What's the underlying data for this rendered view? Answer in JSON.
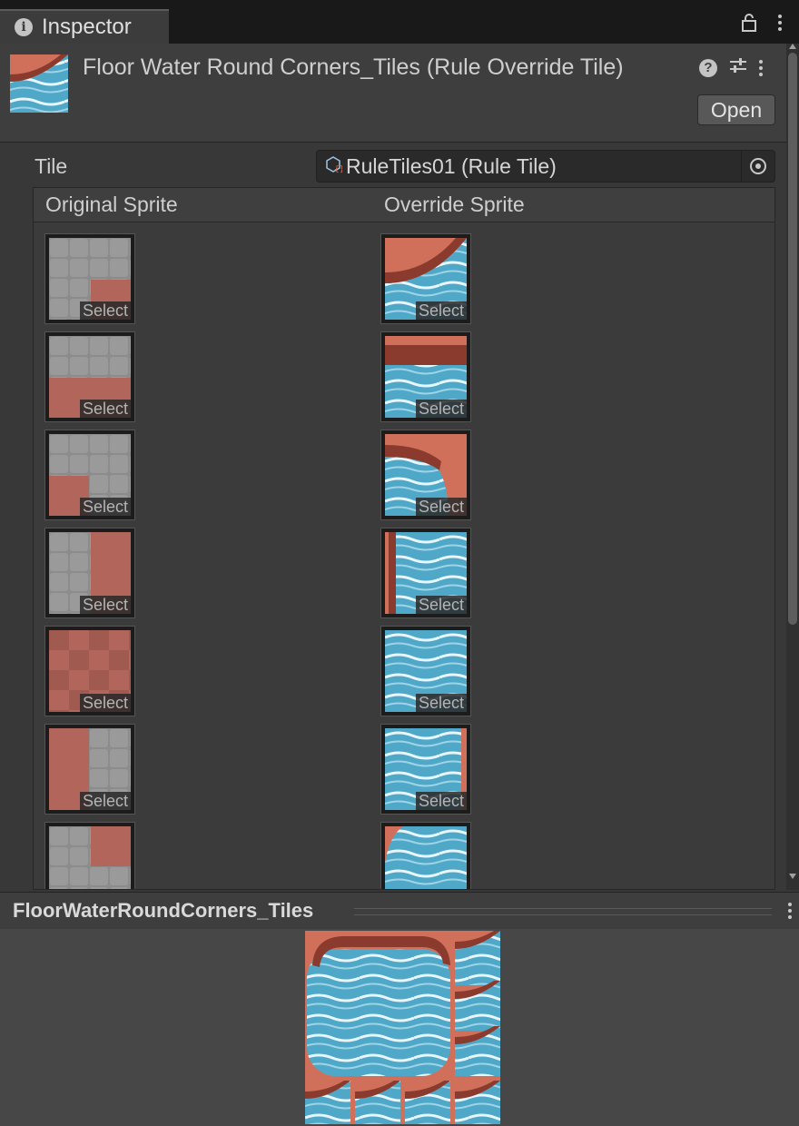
{
  "window": {
    "tab_title": "Inspector",
    "tab_icon": "info-icon"
  },
  "asset": {
    "title": "Floor Water Round Corners_Tiles (Rule Override Tile)",
    "open_label": "Open"
  },
  "tile_field": {
    "label": "Tile",
    "value": "RuleTiles01 (Rule Tile)"
  },
  "columns": {
    "original": "Original Sprite",
    "override": "Override Sprite"
  },
  "rows": [
    {
      "original_select": "Select",
      "override_select": "Select"
    },
    {
      "original_select": "Select",
      "override_select": "Select"
    },
    {
      "original_select": "Select",
      "override_select": "Select"
    },
    {
      "original_select": "Select",
      "override_select": "Select"
    },
    {
      "original_select": "Select",
      "override_select": "Select"
    },
    {
      "original_select": "Select",
      "override_select": "Select"
    }
  ],
  "preview": {
    "title": "FloorWaterRoundCorners_Tiles"
  },
  "colors": {
    "water": "#4fa8c8",
    "clay": "#d0705a",
    "wall": "#8a3b2e",
    "panel": "#383838"
  }
}
